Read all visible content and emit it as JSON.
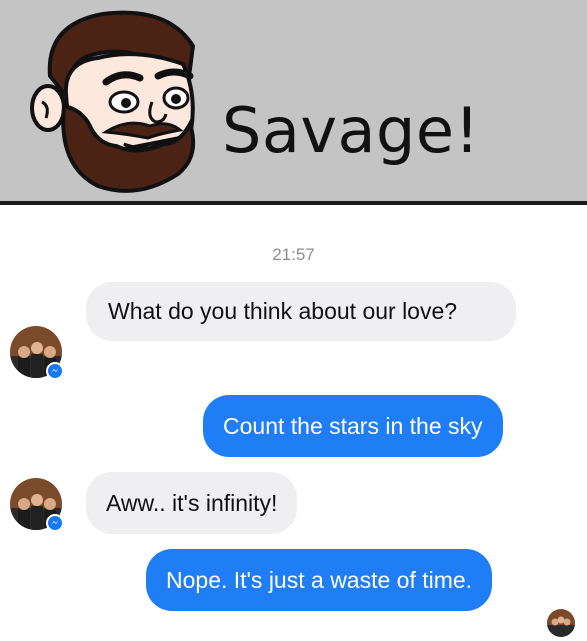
{
  "header": {
    "title": "Savage!",
    "icon": "bearded-man-face-icon"
  },
  "chat": {
    "timestamp": "21:57",
    "messages": [
      {
        "side": "incoming",
        "text": "What do you think about our love?"
      },
      {
        "side": "outgoing",
        "text": "Count the stars in the sky"
      },
      {
        "side": "incoming",
        "text": "Aww.. it's infinity!"
      },
      {
        "side": "outgoing",
        "text": "Nope. It's just a waste of time."
      }
    ]
  },
  "colors": {
    "header_bg": "#c4c4c4",
    "incoming_bubble": "#efeff1",
    "outgoing_bubble": "#1f7ef5",
    "messenger_badge": "#1877f2"
  }
}
